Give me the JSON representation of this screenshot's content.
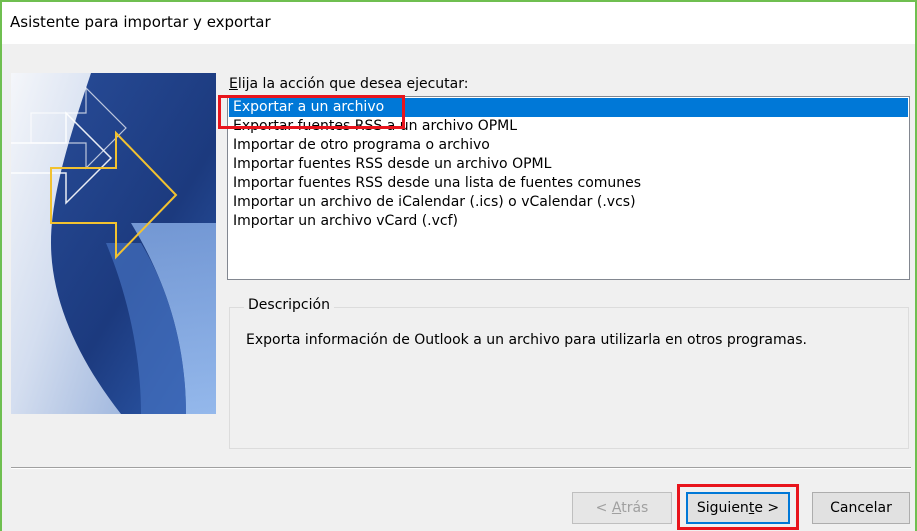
{
  "window": {
    "title": "Asistente para importar y exportar"
  },
  "prompt": {
    "before": "",
    "accel": "E",
    "after": "lija la acción que desea ejecutar:"
  },
  "actions": [
    {
      "label": "Exportar a un archivo",
      "selected": true
    },
    {
      "label": "Exportar fuentes RSS a un archivo OPML",
      "selected": false
    },
    {
      "label": "Importar de otro programa o archivo",
      "selected": false
    },
    {
      "label": "Importar fuentes RSS desde un archivo OPML",
      "selected": false
    },
    {
      "label": "Importar fuentes RSS desde una lista de fuentes comunes",
      "selected": false
    },
    {
      "label": "Importar un archivo de iCalendar (.ics) o vCalendar (.vcs)",
      "selected": false
    },
    {
      "label": "Importar un archivo vCard (.vcf)",
      "selected": false
    }
  ],
  "description": {
    "legend": "Descripción",
    "text": "Exporta información de Outlook a un archivo para utilizarla en otros programas."
  },
  "buttons": {
    "back": {
      "before": "< ",
      "accel": "A",
      "after": "trás",
      "enabled": false
    },
    "next": {
      "before": "Siguien",
      "accel": "t",
      "after": "e >",
      "enabled": true
    },
    "cancel": {
      "label": "Cancelar"
    }
  },
  "colors": {
    "selection": "#0078d7",
    "annotation": "#e8141c",
    "window_border": "#6fbf50"
  }
}
